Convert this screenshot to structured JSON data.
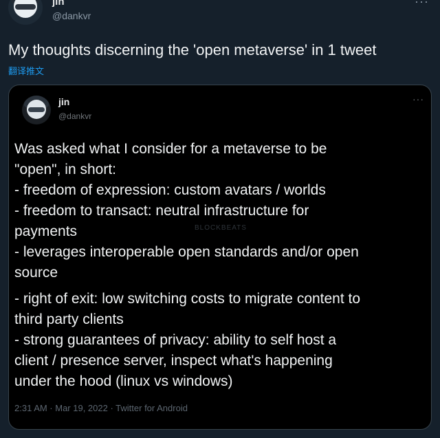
{
  "outer_tweet": {
    "name": "jin",
    "handle": "@dankvr",
    "more": "···",
    "text": "My thoughts discerning the 'open metaverse' in 1 tweet",
    "translate": "翻译推文"
  },
  "quoted_tweet": {
    "name": "jin",
    "handle": "@dankvr",
    "more": "···",
    "lines": [
      "Was asked what I consider for a metaverse to be",
      "\"open\", in short:",
      "- freedom of expression: custom avatars / worlds",
      "- freedom to transact: neutral infrastructure for",
      "payments",
      "- leverages interoperable open standards and/or open",
      "source",
      "- right of exit: low switching costs to migrate content to",
      "third party clients",
      "- strong guarantees of privacy: ability to self host a",
      "client / presence server, inspect what's happening",
      "under the hood (linux vs windows)"
    ],
    "footer": "2:31 AM · Mar 19, 2022 · Twitter for Android"
  },
  "watermark": "BLOCKBEATS",
  "icons": {
    "outer_avatar": "avatar-icon",
    "quoted_avatar": "avatar-icon",
    "more": "more-icon"
  }
}
